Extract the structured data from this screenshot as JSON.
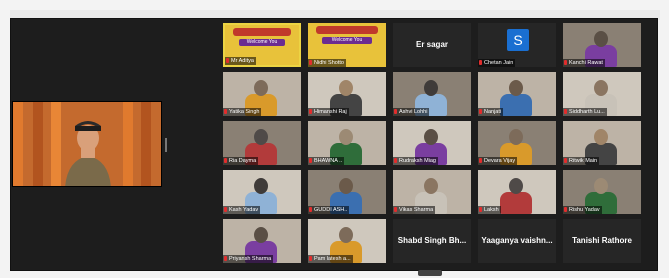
{
  "speaker": {
    "name": "",
    "colors": {
      "curtain": "#c46a2e",
      "uniform": "#7a6a4a"
    }
  },
  "tiles": [
    {
      "name": "Mr Aditya",
      "type": "banner",
      "welcome": "Welcome You",
      "active": true
    },
    {
      "name": "Nidhi Shotto",
      "type": "banner",
      "welcome": "Welcome You"
    },
    {
      "name": "Er sagar",
      "type": "nameonly"
    },
    {
      "name": "Chetan Jain",
      "type": "avatar",
      "initial": "S"
    },
    {
      "name": "Kanchi Rawat",
      "type": "video"
    },
    {
      "name": "Yatika Singh",
      "type": "video"
    },
    {
      "name": "Himanshi Raj",
      "type": "video"
    },
    {
      "name": "Ashvi Lohhi",
      "type": "video"
    },
    {
      "name": "Nanjati",
      "type": "video"
    },
    {
      "name": "Siddharth Lu...",
      "type": "video"
    },
    {
      "name": "Ria Dayma",
      "type": "video"
    },
    {
      "name": "BHAWNA ..",
      "type": "video"
    },
    {
      "name": "Rudraksh Miag",
      "type": "video"
    },
    {
      "name": "Devara Vijay",
      "type": "video"
    },
    {
      "name": "Ritwik Main",
      "type": "video"
    },
    {
      "name": "Kash Yadav",
      "type": "video"
    },
    {
      "name": "GUDDI ASH..",
      "type": "video"
    },
    {
      "name": "Vikas Sharma",
      "type": "video"
    },
    {
      "name": "Laksh",
      "type": "video"
    },
    {
      "name": "Rishu Yadav",
      "type": "video"
    },
    {
      "name": "Priyansh Sharma",
      "type": "video"
    },
    {
      "name": "Pam latesh a...",
      "type": "video"
    },
    {
      "name": "Shabd Singh Bh...",
      "type": "nameonly"
    },
    {
      "name": "Yaaganya vaishn...",
      "type": "nameonly"
    },
    {
      "name": "Tanishi Rathore",
      "type": "nameonly"
    }
  ]
}
